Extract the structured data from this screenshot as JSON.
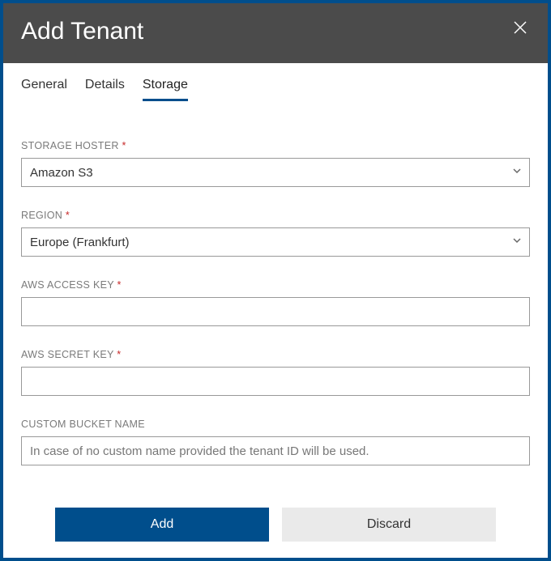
{
  "header": {
    "title": "Add Tenant"
  },
  "tabs": [
    {
      "label": "General"
    },
    {
      "label": "Details"
    },
    {
      "label": "Storage"
    }
  ],
  "form": {
    "storage_hoster": {
      "label": "STORAGE HOSTER",
      "value": "Amazon S3",
      "required": true
    },
    "region": {
      "label": "REGION",
      "value": "Europe (Frankfurt)",
      "required": true
    },
    "aws_access_key": {
      "label": "AWS ACCESS KEY",
      "value": "",
      "required": true
    },
    "aws_secret_key": {
      "label": "AWS SECRET KEY",
      "value": "",
      "required": true
    },
    "custom_bucket_name": {
      "label": "CUSTOM BUCKET NAME",
      "value": "",
      "placeholder": "In case of no custom name provided the tenant ID will be used.",
      "required": false
    }
  },
  "buttons": {
    "add": "Add",
    "discard": "Discard"
  },
  "required_mark": "*"
}
